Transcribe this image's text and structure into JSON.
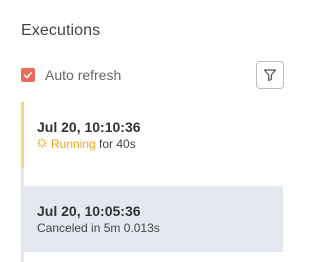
{
  "panel": {
    "title": "Executions"
  },
  "auto_refresh": {
    "label": "Auto refresh",
    "checked": true,
    "color": "#ea6b59"
  },
  "filter_button": {
    "icon": "filter-icon"
  },
  "executions": [
    {
      "date": "Jul 20, 10:10:36",
      "status": "Running",
      "duration": "for 40s",
      "status_color": "#f0a623",
      "icon": "spinner-icon"
    },
    {
      "date": "Jul 20, 10:05:36",
      "status_text": "Canceled in 5m 0.013s",
      "selected": true
    }
  ]
}
